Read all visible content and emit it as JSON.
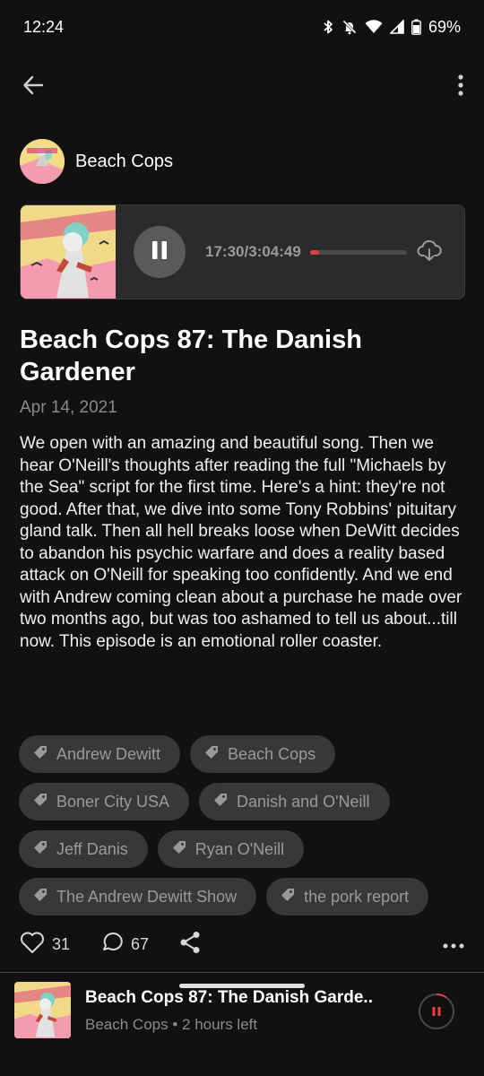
{
  "status": {
    "time": "12:24",
    "battery": "69%"
  },
  "podcast": {
    "name": "Beach Cops"
  },
  "player": {
    "time_display": "17:30/3:04:49",
    "progress": 0.095,
    "accent_color": "#e84040"
  },
  "episode": {
    "title": "Beach Cops 87: The Danish Gardener",
    "date": "Apr 14, 2021",
    "description": "We open with an amazing and beautiful song.  Then we hear O'Neill's thoughts after reading the full \"Michaels by the Sea\" script for the first time.  Here's a hint: they're not good.  After that, we dive into some Tony Robbins' pituitary gland talk.  Then all hell breaks loose when DeWitt decides to abandon his psychic warfare and does a reality based  attack on O'Neill for speaking too confidently.  And we end with Andrew coming clean about a purchase he made over two months ago, but was too ashamed to tell us about...till now.  This episode is an emotional roller coaster."
  },
  "tags": [
    {
      "label": "Andrew Dewitt"
    },
    {
      "label": "Beach Cops"
    },
    {
      "label": "Boner City USA"
    },
    {
      "label": "Danish and O'Neill"
    },
    {
      "label": "Jeff Danis"
    },
    {
      "label": "Ryan O'Neill"
    },
    {
      "label": "The Andrew Dewitt Show"
    },
    {
      "label": "the pork report"
    }
  ],
  "actions": {
    "likes": "31",
    "comments": "67"
  },
  "mini_player": {
    "title": "Beach Cops 87: The Danish Garde..",
    "subtitle": "Beach Cops • 2 hours left"
  }
}
